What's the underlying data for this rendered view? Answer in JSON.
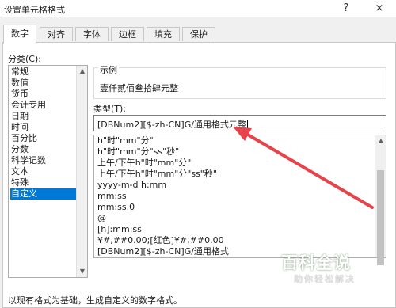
{
  "window": {
    "title": "设置单元格格式",
    "help_label": "?",
    "close_label": "×"
  },
  "tabs": [
    {
      "label": "数字"
    },
    {
      "label": "对齐"
    },
    {
      "label": "字体"
    },
    {
      "label": "边框"
    },
    {
      "label": "填充"
    },
    {
      "label": "保护"
    }
  ],
  "category": {
    "label": "分类(C):",
    "items": [
      "常规",
      "数值",
      "货币",
      "会计专用",
      "日期",
      "时间",
      "百分比",
      "分数",
      "科学记数",
      "文本",
      "特殊",
      "自定义"
    ],
    "selected": "自定义"
  },
  "sample": {
    "label": "示例",
    "value": "壹仟贰佰叁拾肆元整"
  },
  "type": {
    "label": "类型(T):",
    "value": "[DBNum2][$-zh-CN]G/通用格式元整",
    "formats": [
      "h\"时\"mm\"分\"",
      "h\"时\"mm\"分\"ss\"秒\"",
      "上午/下午h\"时\"mm\"分\"",
      "上午/下午h\"时\"mm\"分\"ss\"秒\"",
      "yyyy-m-d h:mm",
      "mm:ss",
      "mm:ss.0",
      "@",
      "[h]:mm:ss",
      "¥#,##0.00;[红色]¥#,##0.00",
      "[DBNum2][$-zh-CN]G/通用格式"
    ]
  },
  "hint": "以现有格式为基础，生成自定义的数字格式。",
  "watermark": {
    "main": "百科全说",
    "sub": "助你轻松解决"
  },
  "colors": {
    "selection": "#0078d7",
    "annotation_arrow": "#e8434a"
  }
}
